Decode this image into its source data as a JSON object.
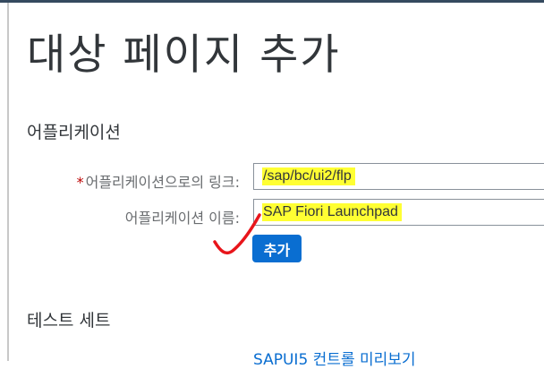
{
  "page": {
    "title": "대상 페이지 추가"
  },
  "application_section": {
    "heading": "어플리케이션",
    "link_field": {
      "required_marker": "*",
      "label": "어플리케이션으로의 링크:",
      "value": "/sap/bc/ui2/flp"
    },
    "name_field": {
      "label": "어플리케이션 이름:",
      "value": "SAP Fiori Launchpad"
    },
    "add_button_label": "추가"
  },
  "test_section": {
    "heading": "테스트 세트",
    "preview_link": "SAPUI5 컨트롤 미리보기"
  },
  "colors": {
    "accent": "#0a6ed1",
    "highlight": "#ffff33",
    "annotation": "#e8151b",
    "required": "#bb0000"
  }
}
